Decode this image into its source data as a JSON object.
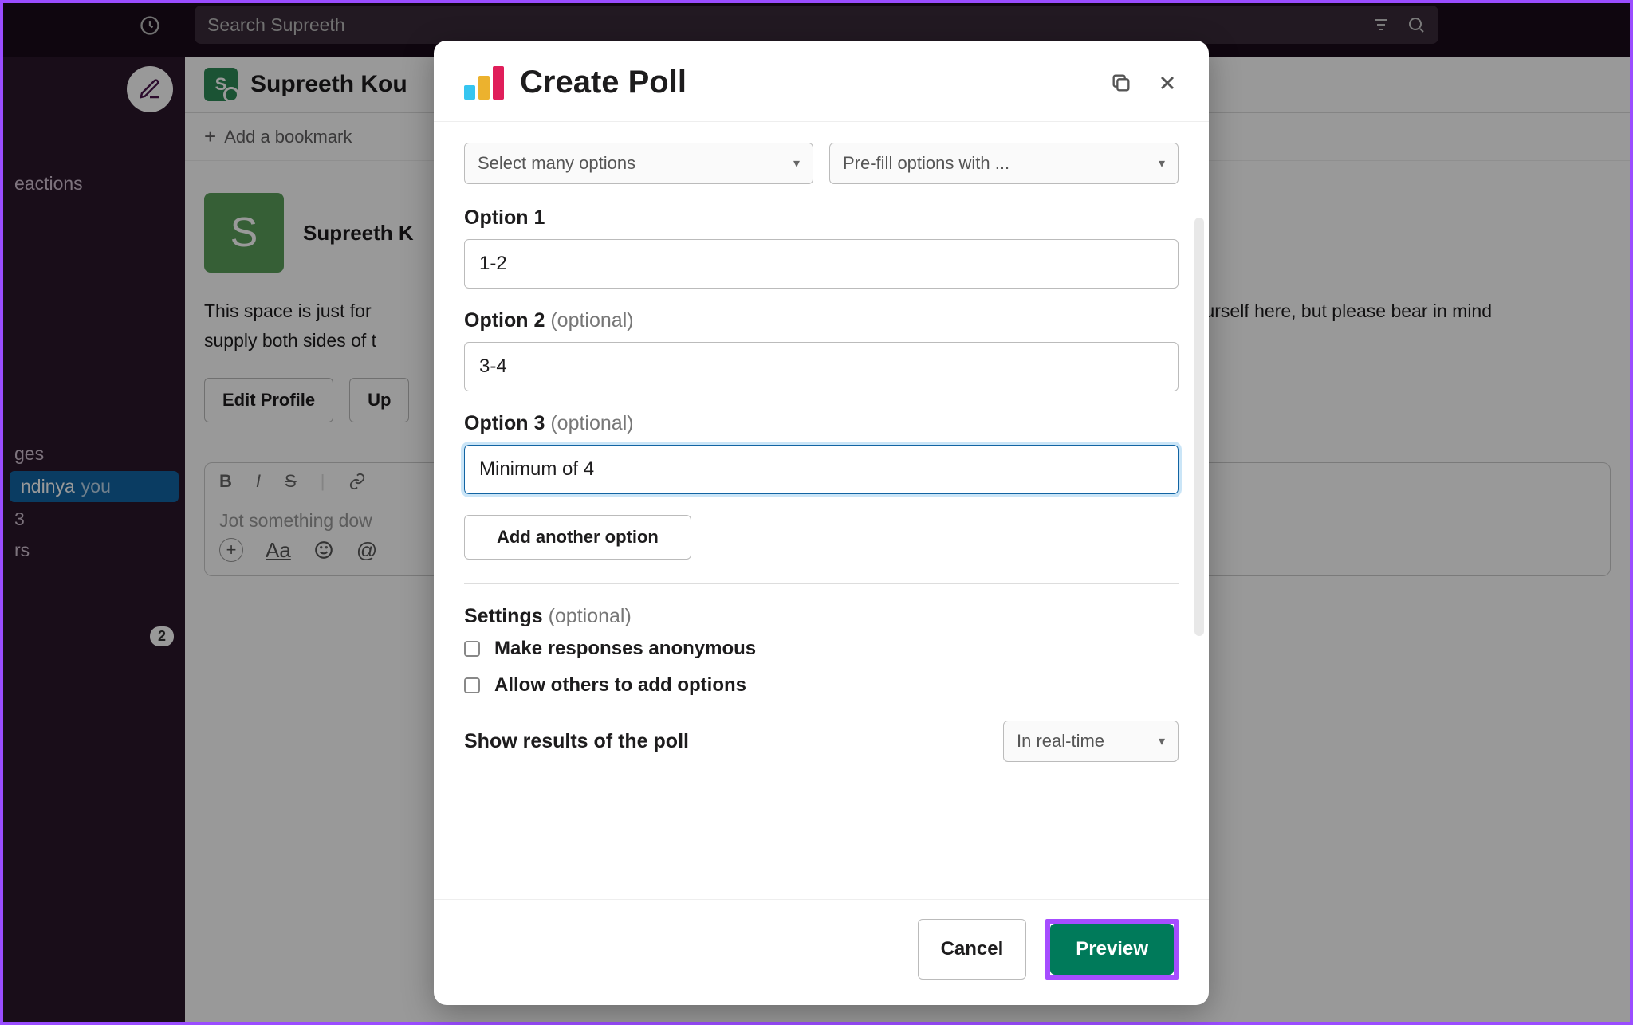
{
  "search": {
    "placeholder": "Search Supreeth"
  },
  "sidebar": {
    "items": [
      "eactions",
      "ges",
      "ndinya",
      "3",
      "rs"
    ],
    "you_label": "you",
    "badge": "2"
  },
  "channel": {
    "avatar_letter": "S",
    "title": "Supreeth Kou",
    "add_bookmark": "Add a bookmark"
  },
  "user_block": {
    "avatar_letter": "S",
    "name": "Supreeth K",
    "desc_line1": "This space is just for",
    "desc_line1_tail": "talk to yourself here, but please bear in mind",
    "desc_line2": "supply both sides of t",
    "edit_profile": "Edit Profile",
    "upload_button_start": "Up"
  },
  "composer": {
    "placeholder": "Jot something dow"
  },
  "modal": {
    "title": "Create Poll",
    "select1": "Select many options",
    "select2": "Pre-fill options with ...",
    "option1_label": "Option 1",
    "option1_value": "1-2",
    "option2_label": "Option 2",
    "option2_optional": "(optional)",
    "option2_value": "3-4",
    "option3_label": "Option 3",
    "option3_optional": "(optional)",
    "option3_value": "Minimum of 4",
    "add_option": "Add another option",
    "settings_label": "Settings",
    "settings_optional": "(optional)",
    "anon_label": "Make responses anonymous",
    "others_label": "Allow others to add options",
    "results_label": "Show results of the poll",
    "results_select": "In real-time",
    "cancel": "Cancel",
    "preview": "Preview"
  }
}
